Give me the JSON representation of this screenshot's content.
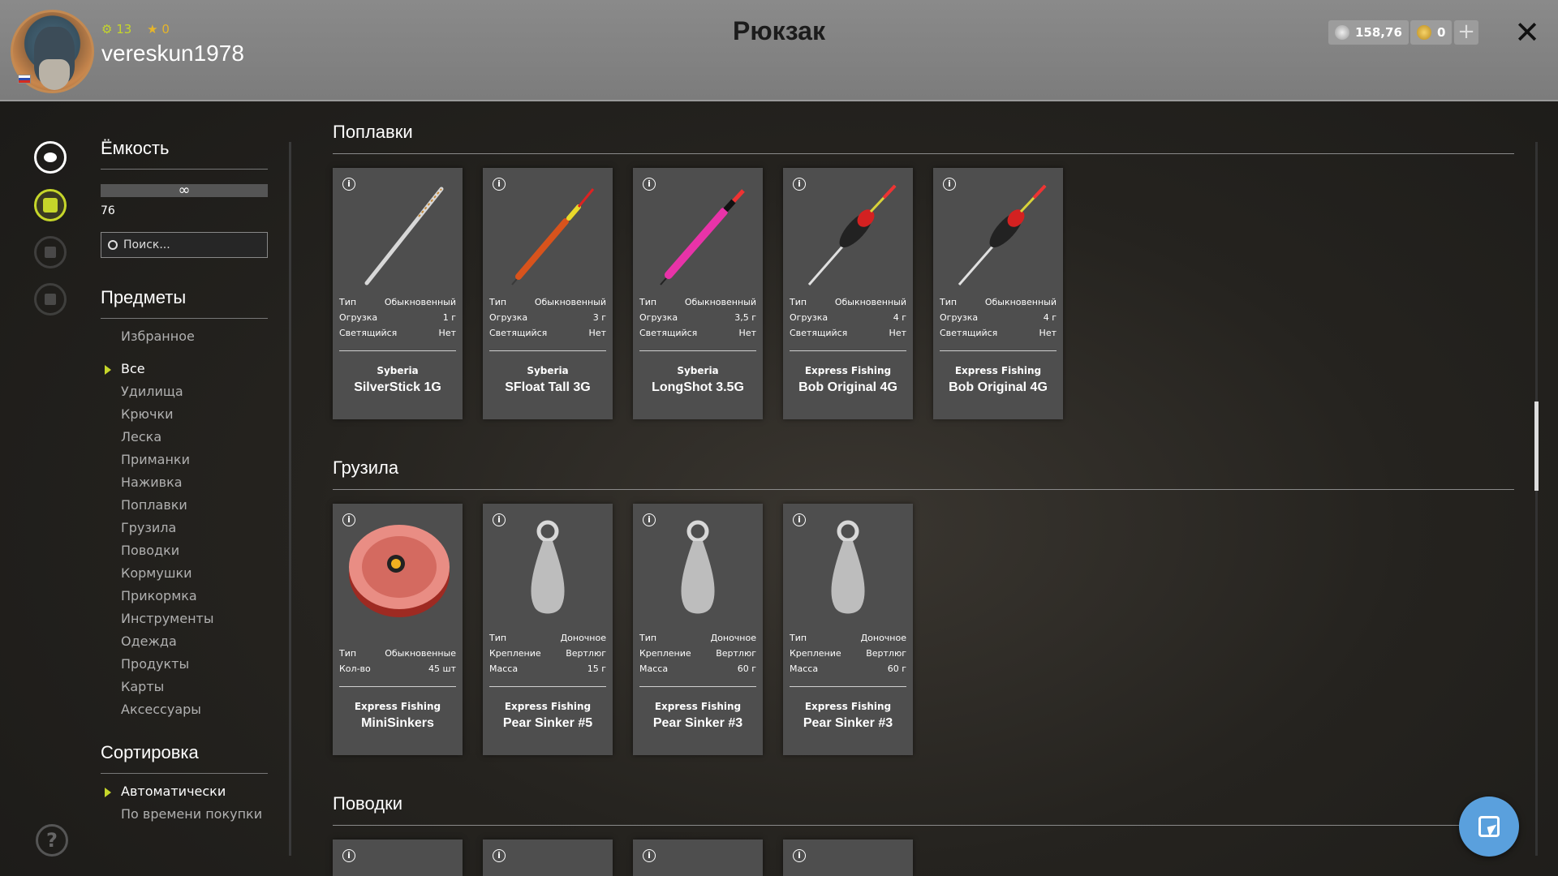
{
  "header": {
    "title": "Рюкзак",
    "username": "vereskun1978",
    "level": "13",
    "stars": "0",
    "silver": "158,76",
    "gold": "0",
    "plus_label": "+",
    "close_label": "✕"
  },
  "filters": {
    "capacity_heading": "Ёмкость",
    "capacity_value": "∞",
    "capacity_count": "76",
    "search_placeholder": "Поиск...",
    "items_heading": "Предметы",
    "categories": [
      "Избранное",
      "Все",
      "Удилища",
      "Крючки",
      "Леска",
      "Приманки",
      "Наживка",
      "Поплавки",
      "Грузила",
      "Поводки",
      "Кормушки",
      "Прикормка",
      "Инструменты",
      "Одежда",
      "Продукты",
      "Карты",
      "Аксессуары"
    ],
    "sort_heading": "Сортировка",
    "sort_options": [
      "Автоматически",
      "По времени покупки"
    ]
  },
  "sections": {
    "floats": {
      "title": "Поплавки",
      "items": [
        {
          "brand": "Syberia",
          "name": "SilverStick 1G",
          "props": [
            [
              "Тип",
              "Обыкновенный"
            ],
            [
              "Огрузка",
              "1 г"
            ],
            [
              "Светящийся",
              "Нет"
            ]
          ]
        },
        {
          "brand": "Syberia",
          "name": "SFloat Tall 3G",
          "props": [
            [
              "Тип",
              "Обыкновенный"
            ],
            [
              "Огрузка",
              "3 г"
            ],
            [
              "Светящийся",
              "Нет"
            ]
          ]
        },
        {
          "brand": "Syberia",
          "name": "LongShot 3.5G",
          "props": [
            [
              "Тип",
              "Обыкновенный"
            ],
            [
              "Огрузка",
              "3,5 г"
            ],
            [
              "Светящийся",
              "Нет"
            ]
          ]
        },
        {
          "brand": "Express Fishing",
          "name": "Bob Original 4G",
          "props": [
            [
              "Тип",
              "Обыкновенный"
            ],
            [
              "Огрузка",
              "4 г"
            ],
            [
              "Светящийся",
              "Нет"
            ]
          ]
        },
        {
          "brand": "Express Fishing",
          "name": "Bob Original 4G",
          "props": [
            [
              "Тип",
              "Обыкновенный"
            ],
            [
              "Огрузка",
              "4 г"
            ],
            [
              "Светящийся",
              "Нет"
            ]
          ]
        }
      ]
    },
    "sinkers": {
      "title": "Грузила",
      "items": [
        {
          "brand": "Express Fishing",
          "name": "MiniSinkers",
          "props": [
            [
              "Тип",
              "Обыкновенные"
            ],
            [
              "Кол-во",
              "45 шт"
            ]
          ]
        },
        {
          "brand": "Express Fishing",
          "name": "Pear Sinker #5",
          "props": [
            [
              "Тип",
              "Доночное"
            ],
            [
              "Крепление",
              "Вертлюг"
            ],
            [
              "Масса",
              "15 г"
            ]
          ]
        },
        {
          "brand": "Express Fishing",
          "name": "Pear Sinker #3",
          "props": [
            [
              "Тип",
              "Доночное"
            ],
            [
              "Крепление",
              "Вертлюг"
            ],
            [
              "Масса",
              "60 г"
            ]
          ]
        },
        {
          "brand": "Express Fishing",
          "name": "Pear Sinker #3",
          "props": [
            [
              "Тип",
              "Доночное"
            ],
            [
              "Крепление",
              "Вертлюг"
            ],
            [
              "Масса",
              "60 г"
            ]
          ]
        }
      ]
    },
    "leaders": {
      "title": "Поводки"
    }
  },
  "colors": {
    "accent": "#c6d62a",
    "fab": "#5aa0dd"
  }
}
